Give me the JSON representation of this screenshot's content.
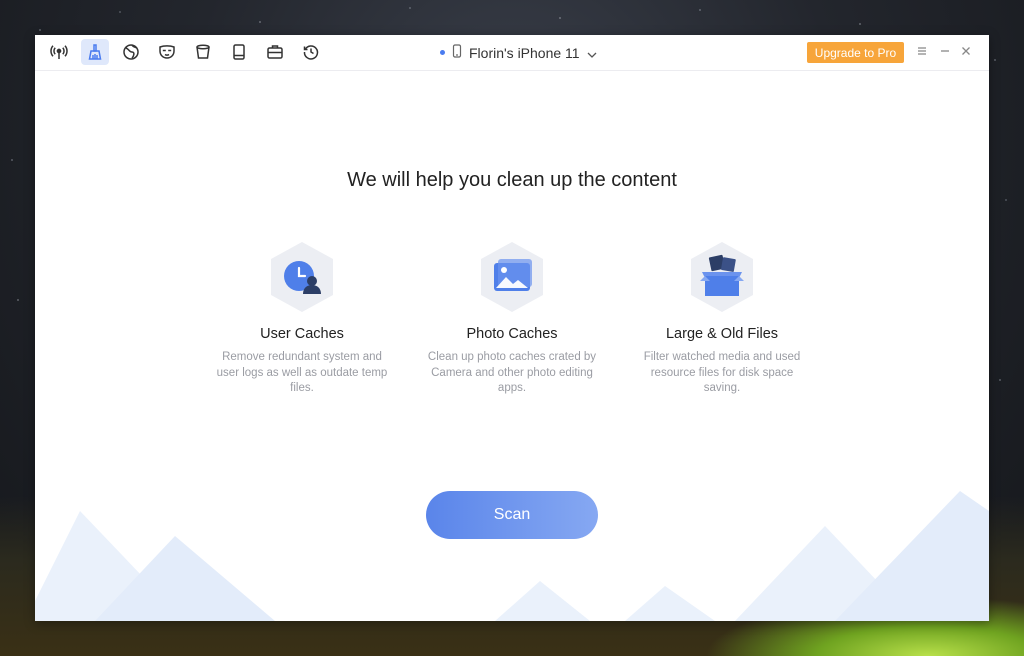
{
  "device": {
    "name": "Florin's iPhone 11"
  },
  "titlebar": {
    "upgrade_label": "Upgrade to Pro"
  },
  "toolbar": {
    "tools": [
      {
        "icon": "wifi-broadcast-icon",
        "active": false
      },
      {
        "icon": "broom-icon",
        "active": true
      },
      {
        "icon": "globe-icon",
        "active": false
      },
      {
        "icon": "mask-icon",
        "active": false
      },
      {
        "icon": "bucket-icon",
        "active": false
      },
      {
        "icon": "book-icon",
        "active": false
      },
      {
        "icon": "toolbox-icon",
        "active": false
      },
      {
        "icon": "history-icon",
        "active": false
      }
    ]
  },
  "main": {
    "heading": "We will help you clean up the content",
    "features": [
      {
        "title": "User Caches",
        "desc": "Remove redundant system and user logs as well as outdate temp files.",
        "icon": "user-clock-icon"
      },
      {
        "title": "Photo Caches",
        "desc": "Clean up photo caches crated by Camera and other photo editing apps.",
        "icon": "photo-icon"
      },
      {
        "title": "Large & Old Files",
        "desc": "Filter watched media and used resource files for disk space saving.",
        "icon": "files-box-icon"
      }
    ],
    "scan_label": "Scan"
  },
  "colors": {
    "accent": "#5a85ea",
    "upgrade": "#f7a53a"
  }
}
